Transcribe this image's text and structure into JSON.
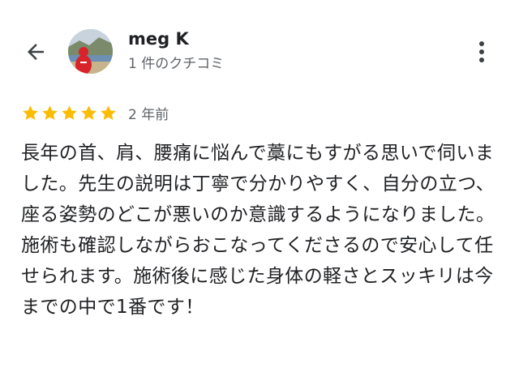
{
  "header": {
    "back_icon": "arrow-left-icon",
    "avatar_icon": "user-avatar-photo",
    "user_name": "meg K",
    "review_count": "1 件のクチコミ",
    "more_icon": "more-vertical-icon"
  },
  "review": {
    "rating": 5,
    "rating_max": 5,
    "star_color": "#fbbc04",
    "date": "2 年前",
    "text": "長年の首、肩、腰痛に悩んで藁にもすがる思いで伺いました。先生の説明は丁寧で分かりやすく、自分の立つ、座る姿勢のどこが悪いのか意識するようになりました。施術も確認しながらおこなってくださるので安心して任せられます。施術後に感じた身体の軽さとスッキリは今までの中で1番です！"
  },
  "colors": {
    "primary_text": "#202124",
    "secondary_text": "#5f6368",
    "icon": "#3c4043"
  }
}
